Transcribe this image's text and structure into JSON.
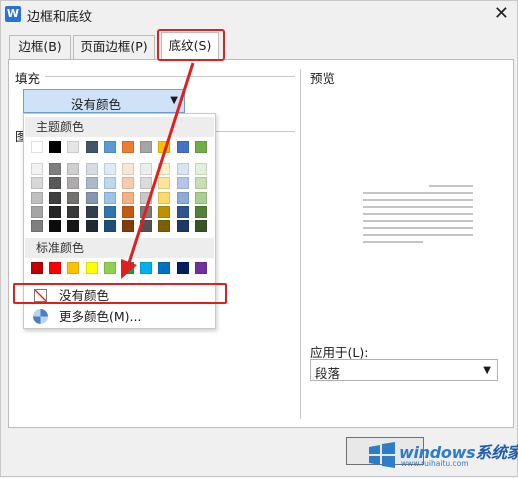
{
  "window": {
    "title": "边框和底纹",
    "app_icon": "W",
    "close_glyph": "✕"
  },
  "tabs": [
    {
      "label": "边框(B)"
    },
    {
      "label": "页面边框(P)"
    },
    {
      "label": "底纹(S)",
      "selected": true
    }
  ],
  "fill": {
    "group_label": "填充",
    "dropdown_value": "没有颜色",
    "dropdown_arrow": "▼"
  },
  "pattern": {
    "group_label_partial": "图"
  },
  "color_popup": {
    "theme_header": "主题颜色",
    "standard_header": "标准颜色",
    "theme_top_row": [
      "#ffffff",
      "#000000",
      "#e7e6e6",
      "#44546a",
      "#5b9bd5",
      "#ed7d31",
      "#a5a5a5",
      "#ffc000",
      "#4472c4",
      "#70ad47"
    ],
    "theme_shades": [
      [
        "#f2f2f2",
        "#7f7f7f",
        "#d0cece",
        "#d6dce4",
        "#deebf6",
        "#fbe5d5",
        "#ededed",
        "#fff2cc",
        "#dae3f3",
        "#e2efd9"
      ],
      [
        "#d8d8d8",
        "#595959",
        "#aeabab",
        "#adb9ca",
        "#bdd7ee",
        "#f7cbac",
        "#dbdbdb",
        "#fee599",
        "#b4c6e7",
        "#c5e0b3"
      ],
      [
        "#bfbfbf",
        "#3f3f3f",
        "#757070",
        "#8496b0",
        "#9dc3e6",
        "#f4b183",
        "#c9c9c9",
        "#ffd966",
        "#8eaadb",
        "#a8d08d"
      ],
      [
        "#a5a5a5",
        "#262626",
        "#3a3838",
        "#323f4f",
        "#2e75b5",
        "#c55a11",
        "#7b7b7b",
        "#bf9000",
        "#2f5496",
        "#538135"
      ],
      [
        "#7f7f7f",
        "#0c0c0c",
        "#171616",
        "#222a35",
        "#1e4e79",
        "#833c0b",
        "#525252",
        "#7f6000",
        "#1f3864",
        "#375623"
      ]
    ],
    "standard_colors": [
      "#c00000",
      "#ff0000",
      "#ffc000",
      "#ffff00",
      "#92d050",
      "#00b050",
      "#00b0f0",
      "#0070c0",
      "#002060",
      "#7030a0"
    ],
    "no_color_label": "没有颜色",
    "more_colors_label": "更多颜色(M)..."
  },
  "preview": {
    "label": "预览"
  },
  "apply_to": {
    "label": "应用于(L):",
    "value": "段落",
    "arrow": "▼"
  },
  "highlight_color": "#e02020",
  "watermark": {
    "brand_a": "windows",
    "brand_b": "系统家园",
    "url": "www.ruihaitu.com"
  }
}
